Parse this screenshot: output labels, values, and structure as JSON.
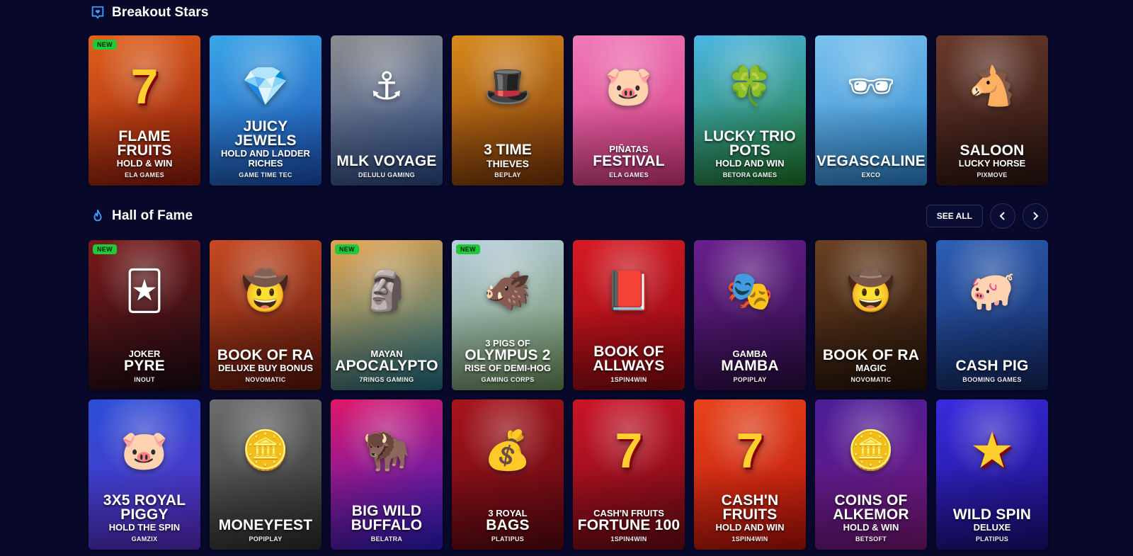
{
  "sections": {
    "breakout": {
      "title": "Breakout Stars",
      "icon": "heart-badge-icon"
    },
    "fame": {
      "title": "Hall of Fame",
      "icon": "flame-icon",
      "see_all": "SEE ALL"
    }
  },
  "badge_new": "NEW",
  "row1": [
    {
      "pre": "",
      "main": "FLAME FRUITS",
      "sub": "HOLD & WIN",
      "provider": "ELA GAMES",
      "is_new": true,
      "bg": "#e2611b",
      "bg2": "#8e1a0c",
      "icon": "seven-fruit-icon",
      "glyph": "7"
    },
    {
      "pre": "",
      "main": "JUICY JEWELS",
      "sub": "HOLD AND LADDER RICHES",
      "provider": "GAME TIME TEC",
      "is_new": false,
      "bg": "#3aa6e8",
      "bg2": "#1b4fb3",
      "icon": "diamond-icon",
      "glyph": "💎"
    },
    {
      "pre": "",
      "main": "MLK VOYAGE",
      "sub": "",
      "provider": "DELULU GAMING",
      "is_new": false,
      "bg": "#8d8d8d",
      "bg2": "#2a4a8a",
      "icon": "sailor-icon",
      "glyph": "⚓"
    },
    {
      "pre": "3 TIME",
      "main": "",
      "sub": "THIEVES",
      "provider": "BEPLAY",
      "is_new": false,
      "bg": "#d98a1c",
      "bg2": "#7a3408",
      "icon": "wizard-icon",
      "glyph": "🎩"
    },
    {
      "pre": "PIÑATAS",
      "main": "FESTIVAL",
      "sub": "",
      "provider": "ELA GAMES",
      "is_new": false,
      "bg": "#f07ab8",
      "bg2": "#d4387f",
      "icon": "pig-pinata-icon",
      "glyph": "🐷"
    },
    {
      "pre": "",
      "main": "LUCKY TRIO POTS",
      "sub": "HOLD AND WIN",
      "provider": "BETORA GAMES",
      "is_new": false,
      "bg": "#4cb6e6",
      "bg2": "#1f7a2a",
      "icon": "pot-of-gold-icon",
      "glyph": "🍀"
    },
    {
      "pre": "",
      "main": "VEGASCALINE",
      "sub": "",
      "provider": "EXCO",
      "is_new": false,
      "bg": "#7bc3ee",
      "bg2": "#2b84cd",
      "icon": "officer-icon",
      "glyph": "🕶"
    },
    {
      "pre": "",
      "main": "SALOON",
      "sub": "LUCKY HORSE",
      "provider": "PIXMOVE",
      "is_new": false,
      "bg": "#6a3a2c",
      "bg2": "#2a1410",
      "icon": "horse-icon",
      "glyph": "🐴"
    }
  ],
  "row2": [
    {
      "pre": "JOKER",
      "main": "PYRE",
      "sub": "",
      "provider": "INOUT",
      "is_new": true,
      "bg": "#7a1a1a",
      "bg2": "#1a0a12",
      "icon": "joker-icon",
      "glyph": "🃏"
    },
    {
      "pre": "",
      "main": "BOOK OF RA",
      "sub": "DELUXE BUY BONUS",
      "provider": "NOVOMATIC",
      "is_new": false,
      "bg": "#c74a22",
      "bg2": "#5a160a",
      "icon": "explorer-icon",
      "glyph": "🤠"
    },
    {
      "pre": "MAYAN",
      "main": "APOCALYPTO",
      "sub": "",
      "provider": "7RINGS GAMING",
      "is_new": true,
      "bg": "#e6a24c",
      "bg2": "#1f6f82",
      "icon": "warrior-icon",
      "glyph": "🗿"
    },
    {
      "pre": "3 PIGS OF",
      "main": "OLYMPUS 2",
      "sub": "RISE OF DEMI-HOG",
      "provider": "GAMING CORPS",
      "is_new": true,
      "bg": "#b9cfe0",
      "bg2": "#6a8e5a",
      "icon": "boar-icon",
      "glyph": "🐗"
    },
    {
      "pre": "",
      "main": "BOOK OF ALLWAYS",
      "sub": "",
      "provider": "1SPIN4WIN",
      "is_new": false,
      "bg": "#d81a24",
      "bg2": "#8a0810",
      "icon": "book-icon",
      "glyph": "📕"
    },
    {
      "pre": "GAMBA",
      "main": "MAMBA",
      "sub": "",
      "provider": "POPIPLAY",
      "is_new": false,
      "bg": "#6a1f8e",
      "bg2": "#2a0c44",
      "icon": "mask-icon",
      "glyph": "🎭"
    },
    {
      "pre": "",
      "main": "BOOK OF RA",
      "sub": "MAGIC",
      "provider": "NOVOMATIC",
      "is_new": false,
      "bg": "#6a4022",
      "bg2": "#241208",
      "icon": "explorer-icon",
      "glyph": "🤠"
    },
    {
      "pre": "",
      "main": "CASH PIG",
      "sub": "",
      "provider": "BOOMING GAMES",
      "is_new": false,
      "bg": "#2d5fb6",
      "bg2": "#12265e",
      "icon": "piggy-bank-icon",
      "glyph": "🐖"
    }
  ],
  "row3": [
    {
      "pre": "",
      "main": "3X5 ROYAL PIGGY",
      "sub": "HOLD THE SPIN",
      "provider": "GAMZIX",
      "is_new": false,
      "bg": "#2b4fd6",
      "bg2": "#5a2bc4",
      "icon": "royal-piggy-icon",
      "glyph": "🐷"
    },
    {
      "pre": "",
      "main": "MONEYFEST",
      "sub": "",
      "provider": "POPIPLAY",
      "is_new": false,
      "bg": "#6d6d6d",
      "bg2": "#2c2c2c",
      "icon": "piggy-coin-icon",
      "glyph": "🪙"
    },
    {
      "pre": "",
      "main": "BIG WILD BUFFALO",
      "sub": "",
      "provider": "BELATRA",
      "is_new": false,
      "bg": "#e0186a",
      "bg2": "#2a1cc4",
      "icon": "buffalo-icon",
      "glyph": "🦬"
    },
    {
      "pre": "3 ROYAL",
      "main": "BAGS",
      "sub": "",
      "provider": "PLATIPUS",
      "is_new": false,
      "bg": "#a8141c",
      "bg2": "#5a0810",
      "icon": "money-bag-icon",
      "glyph": "💰"
    },
    {
      "pre": "CASH'N FRUITS",
      "main": "FORTUNE 100",
      "sub": "",
      "provider": "1SPIN4WIN",
      "is_new": false,
      "bg": "#cc1428",
      "bg2": "#6e0a14",
      "icon": "seven-bell-icon",
      "glyph": "7"
    },
    {
      "pre": "",
      "main": "CASH'N FRUITS",
      "sub": "HOLD AND WIN",
      "provider": "1SPIN4WIN",
      "is_new": false,
      "bg": "#e8441c",
      "bg2": "#b61208",
      "icon": "mini-seven-icon",
      "glyph": "7"
    },
    {
      "pre": "",
      "main": "COINS OF ALKEMOR",
      "sub": "HOLD & WIN",
      "provider": "BETSOFT",
      "is_new": false,
      "bg": "#4a1e9a",
      "bg2": "#7a1678",
      "icon": "gold-coin-icon",
      "glyph": "🪙"
    },
    {
      "pre": "",
      "main": "WILD SPIN",
      "sub": "DELUXE",
      "provider": "PLATIPUS",
      "is_new": false,
      "bg": "#3a2be0",
      "bg2": "#1a0e7a",
      "icon": "wild-logo-icon",
      "glyph": "★"
    }
  ]
}
